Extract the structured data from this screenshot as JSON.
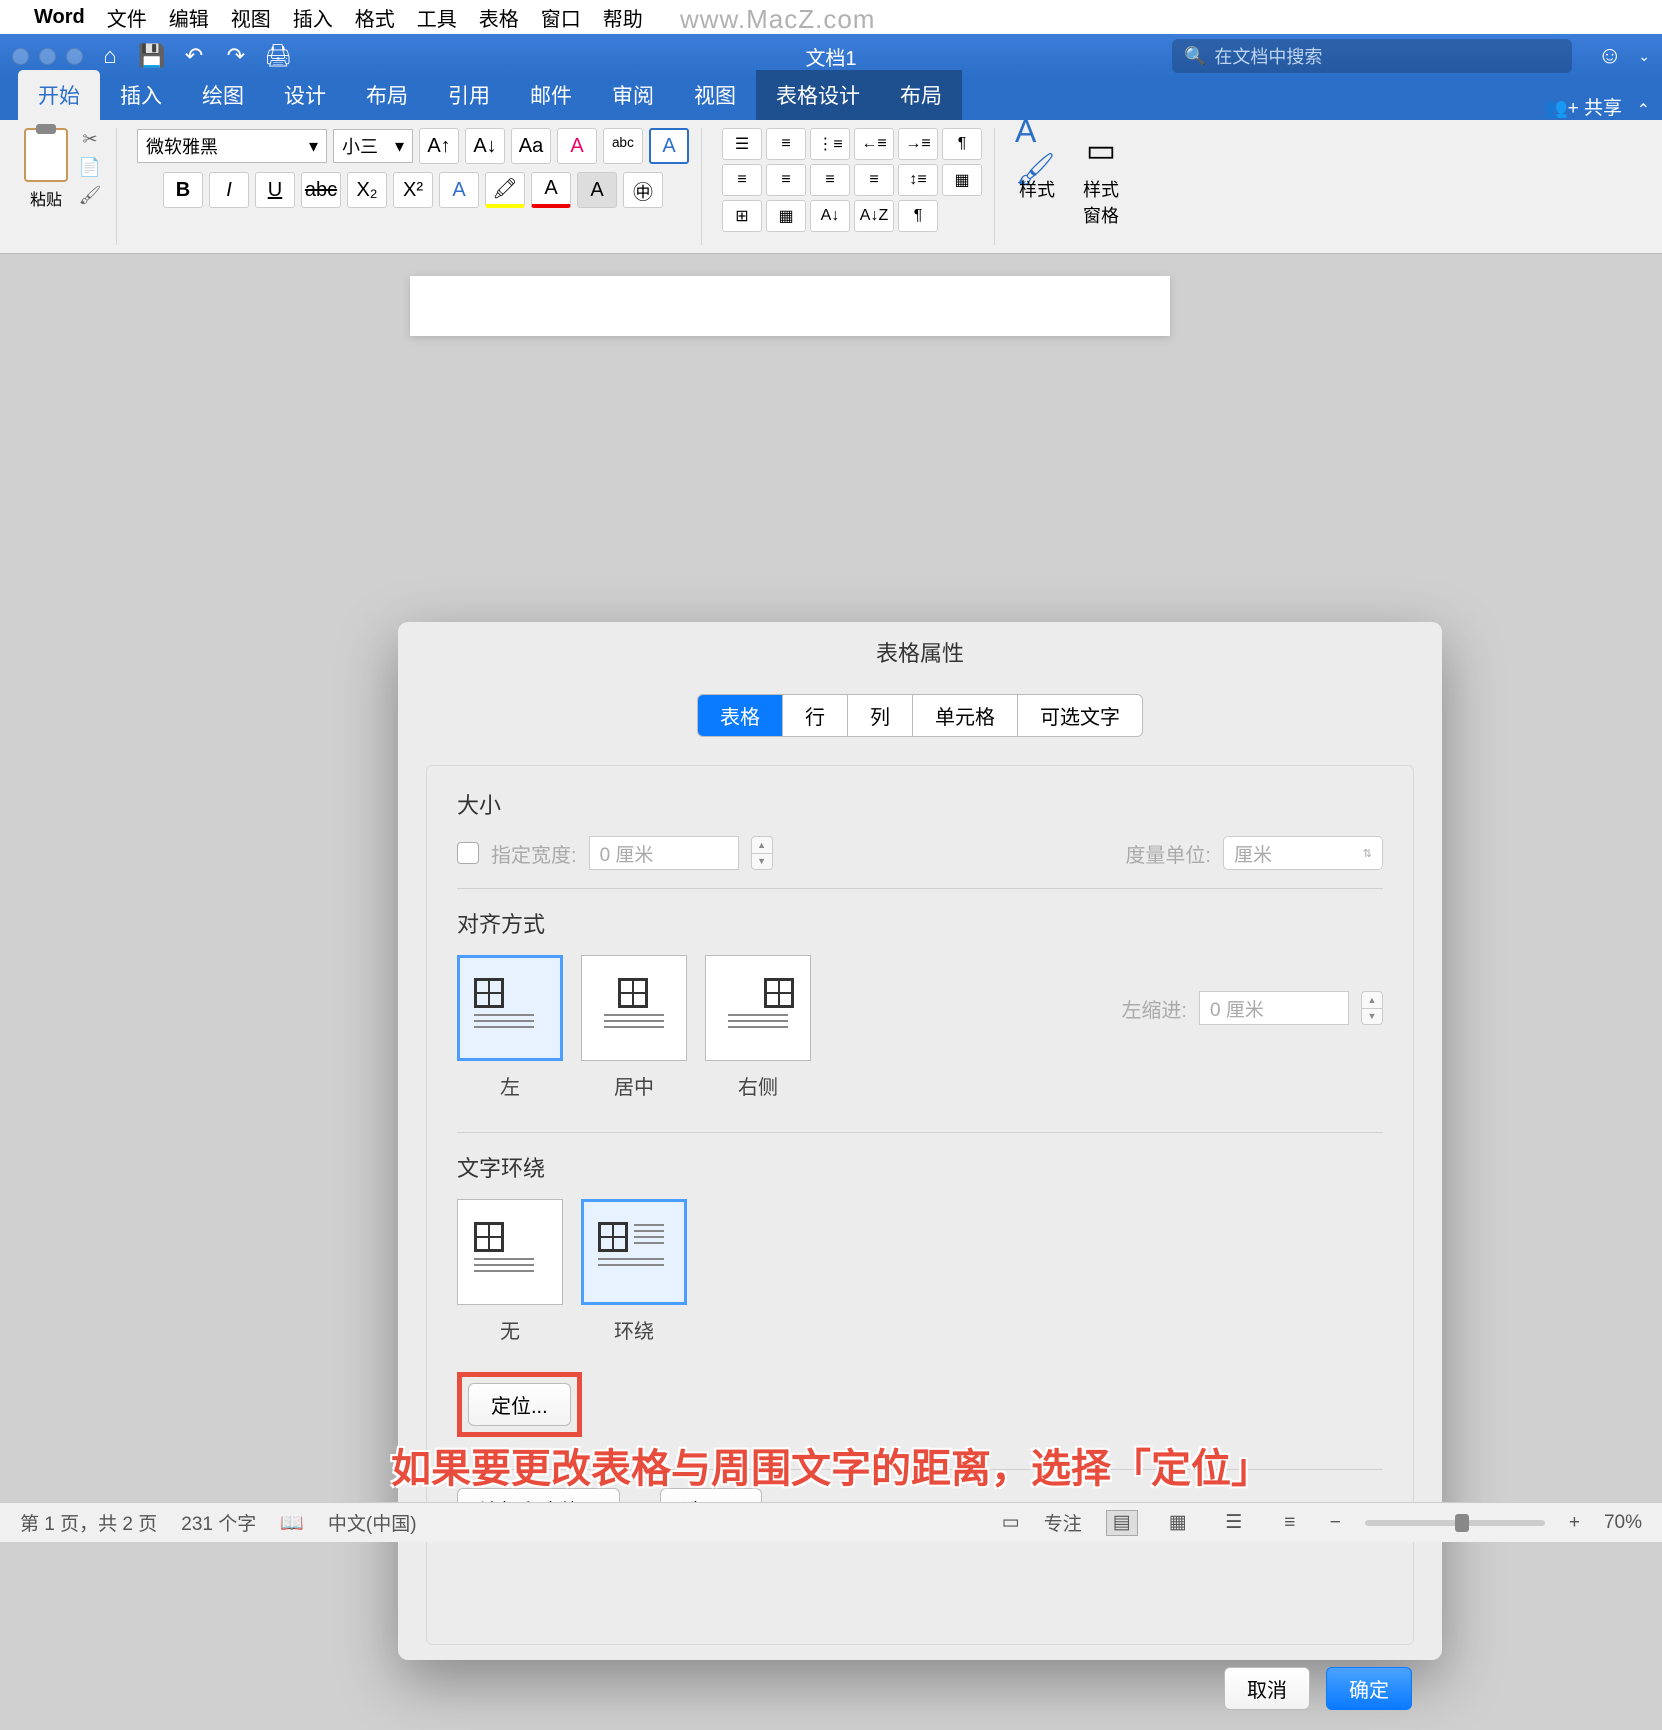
{
  "menubar": {
    "app": "Word",
    "items": [
      "文件",
      "编辑",
      "视图",
      "插入",
      "格式",
      "工具",
      "表格",
      "窗口",
      "帮助"
    ]
  },
  "watermark": "www.MacZ.com",
  "titlebar": {
    "doc_title": "文档1",
    "search_placeholder": "在文档中搜索"
  },
  "ribbon_tabs": {
    "items": [
      "开始",
      "插入",
      "绘图",
      "设计",
      "布局",
      "引用",
      "邮件",
      "审阅",
      "视图",
      "表格设计",
      "布局"
    ],
    "active_index": 0,
    "context_start": 9,
    "share": "共享"
  },
  "ribbon": {
    "paste": "粘贴",
    "font_name": "微软雅黑",
    "font_size": "小三",
    "styles": "样式",
    "styles_pane": "样式\n窗格"
  },
  "dialog": {
    "title": "表格属性",
    "tabs": [
      "表格",
      "行",
      "列",
      "单元格",
      "可选文字"
    ],
    "active_tab": 0,
    "size_label": "大小",
    "width_label": "指定宽度:",
    "width_value": "0 厘米",
    "unit_label": "度量单位:",
    "unit_value": "厘米",
    "align_label": "对齐方式",
    "align_options": [
      "左",
      "居中",
      "右侧"
    ],
    "indent_label": "左缩进:",
    "indent_value": "0 厘米",
    "wrap_label": "文字环绕",
    "wrap_options": [
      "无",
      "环绕"
    ],
    "position_btn": "定位...",
    "border_btn": "边框和底纹...",
    "options_btn": "选项...",
    "cancel": "取消",
    "ok": "确定"
  },
  "annotation": "如果要更改表格与周围文字的距离，选择「定位」",
  "statusbar": {
    "page": "第 1 页，共 2 页",
    "words": "231 个字",
    "lang": "中文(中国)",
    "focus": "专注",
    "zoom": "70%"
  }
}
